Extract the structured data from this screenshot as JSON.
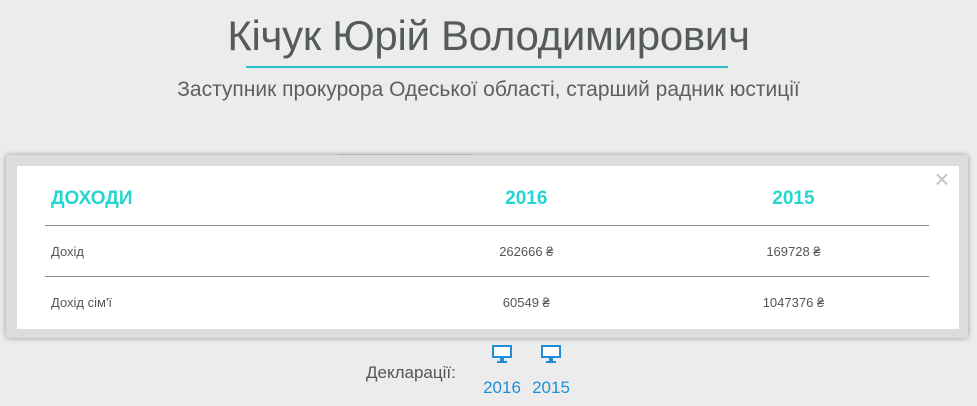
{
  "person": {
    "name": "Кічук Юрій Володимирович",
    "position": "Заступник прокурора Одеської області, старший радник юстиції"
  },
  "modal": {
    "close_label": "×",
    "headers": [
      "ДОХОДИ",
      "2016",
      "2015"
    ],
    "rows": [
      {
        "label": "Дохід",
        "v2016": "262666 ₴",
        "v2015": "169728 ₴"
      },
      {
        "label": "Дохід сім'ї",
        "v2016": "60549 ₴",
        "v2015": "1047376 ₴"
      }
    ]
  },
  "declarations": {
    "label": "Декларації:",
    "items": [
      {
        "year": "2016",
        "icon": "monitor-icon"
      },
      {
        "year": "2015",
        "icon": "monitor-icon"
      }
    ]
  },
  "colors": {
    "accent": "#25d5cf",
    "link": "#1e8fd6",
    "text": "#555a5c"
  }
}
